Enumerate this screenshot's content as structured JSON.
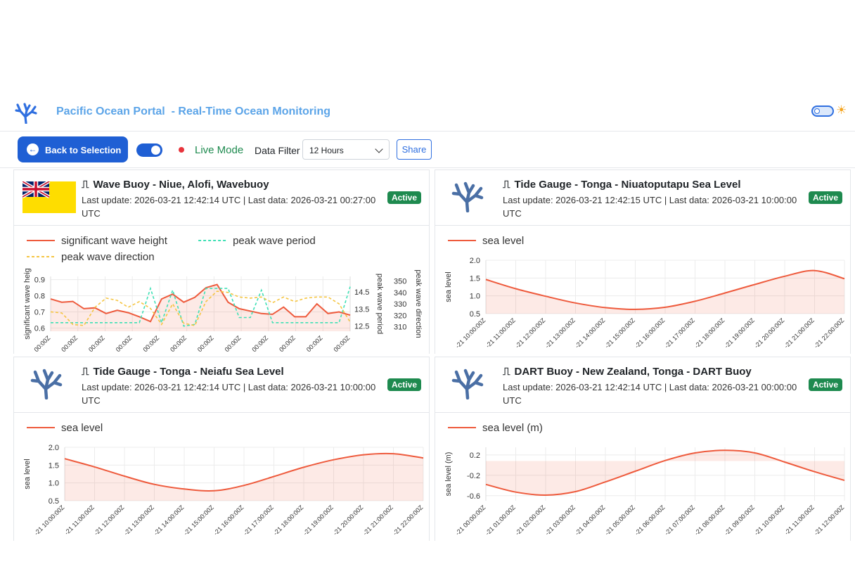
{
  "header": {
    "title": "Pacific Ocean Portal  - Real-Time Ocean Monitoring",
    "logo_icon": "coral-logo-icon",
    "theme_icon": "sun-icon",
    "brand_color": "#5ba4e8"
  },
  "toolbar": {
    "back_label": "Back to Selection",
    "back_icon": "arrow-left-circle-icon",
    "live_label": "Live Mode",
    "filter_label": "Data Filter",
    "filter_value": "12 Hours",
    "share_label": "Share"
  },
  "cards": [
    {
      "title": "Wave Buoy - Niue, Alofi, Wavebuoy",
      "subtitle": "Last update: 2026-03-21 12:42:14 UTC | Last data: 2026-03-21 00:27:00 UTC",
      "status": "Active",
      "icon": "niue-flag"
    },
    {
      "title": "Tide Gauge - Tonga - Niuatoputapu Sea Level",
      "subtitle": "Last update: 2026-03-21 12:42:15 UTC | Last data: 2026-03-21 10:00:00 UTC",
      "status": "Active",
      "icon": "coral-icon"
    },
    {
      "title": "Tide Gauge - Tonga - Neiafu Sea Level",
      "subtitle": "Last update: 2026-03-21 12:42:14 UTC | Last data: 2026-03-21 10:00:00 UTC",
      "status": "Active",
      "icon": "coral-icon"
    },
    {
      "title": "DART Buoy - New Zealand, Tonga - DART Buoy",
      "subtitle": "Last update: 2026-03-21 12:42:14 UTC | Last data: 2026-03-21 00:00:00 UTC",
      "status": "Active",
      "icon": "coral-icon"
    }
  ],
  "colors": {
    "primary": "#1f5fd4",
    "active": "#1e8a4f",
    "live_dot": "#e8343c",
    "series_red": "#ee5a3c",
    "series_teal": "#3fe0b5",
    "series_yellow": "#f5c542"
  },
  "chart_data": [
    {
      "type": "line",
      "legend": [
        "significant wave height",
        "peak wave period",
        "peak wave direction"
      ],
      "ylabel": "significant wave heig",
      "y2label": "peak wave period",
      "y3label": "peak wave direction",
      "yticks": [
        "0.9",
        "0.8",
        "0.7",
        "0.6"
      ],
      "y2ticks": [
        "14.5",
        "13.5",
        "12.5"
      ],
      "y3ticks": [
        "350",
        "340",
        "330",
        "320",
        "310"
      ],
      "ylim": [
        0.58,
        0.92
      ],
      "y2lim": [
        12.2,
        15.4
      ],
      "y3lim": [
        306,
        354
      ],
      "xticks": [
        "00:00Z",
        "00:00Z",
        "00:00Z",
        "00:00Z",
        "00:00Z",
        "00:00Z",
        "00:00Z",
        "00:00Z",
        "00:00Z",
        "00:00Z",
        "00:00Z",
        "00:00Z"
      ],
      "series": [
        {
          "name": "significant wave height",
          "style": "solid",
          "fill": true,
          "values": [
            0.78,
            0.76,
            0.765,
            0.72,
            0.725,
            0.69,
            0.71,
            0.695,
            0.67,
            0.64,
            0.78,
            0.81,
            0.76,
            0.79,
            0.85,
            0.87,
            0.76,
            0.72,
            0.705,
            0.69,
            0.685,
            0.73,
            0.67,
            0.67,
            0.75,
            0.69,
            0.7,
            0.68
          ]
        },
        {
          "name": "peak wave period",
          "style": "dashed",
          "values": [
            12.7,
            12.7,
            12.7,
            12.7,
            12.7,
            12.7,
            12.7,
            12.7,
            12.7,
            14.7,
            12.7,
            14.6,
            12.5,
            12.6,
            14.7,
            14.7,
            14.7,
            13.0,
            13.0,
            14.6,
            12.7,
            12.7,
            12.7,
            12.7,
            12.7,
            12.7,
            12.7,
            14.8
          ]
        },
        {
          "name": "peak wave direction",
          "style": "dashed",
          "values": [
            323,
            322,
            312,
            311,
            327,
            335,
            333,
            327,
            332,
            326,
            312,
            330,
            313,
            311,
            332,
            341,
            340,
            336,
            335,
            336,
            331,
            336,
            332,
            335,
            336,
            336,
            330,
            314
          ]
        }
      ]
    },
    {
      "type": "line",
      "legend": [
        "sea level"
      ],
      "ylabel": "sea level",
      "yticks": [
        "2.0",
        "1.5",
        "1.0",
        "0.5"
      ],
      "ylim": [
        0.5,
        2.0
      ],
      "xticks": [
        "-21 10:00:00Z",
        "-21 11:00:00Z",
        "-21 12:00:00Z",
        "-21 13:00:00Z",
        "-21 14:00:00Z",
        "-21 15:00:00Z",
        "-21 16:00:00Z",
        "-21 17:00:00Z",
        "-21 18:00:00Z",
        "-21 19:00:00Z",
        "-21 20:00:00Z",
        "-21 21:00:00Z",
        "-21 22:00:00Z"
      ],
      "series": [
        {
          "name": "sea level",
          "style": "solid",
          "fill": true,
          "values": [
            1.46,
            1.2,
            0.99,
            0.8,
            0.67,
            0.62,
            0.68,
            0.85,
            1.08,
            1.32,
            1.55,
            1.71,
            1.48
          ]
        }
      ]
    },
    {
      "type": "line",
      "legend": [
        "sea level"
      ],
      "ylabel": "sea level",
      "yticks": [
        "2.0",
        "1.5",
        "1.0",
        "0.5"
      ],
      "ylim": [
        0.5,
        2.0
      ],
      "xticks": [
        "-21 10:00:00Z",
        "-21 11:00:00Z",
        "-21 12:00:00Z",
        "-21 13:00:00Z",
        "-21 14:00:00Z",
        "-21 15:00:00Z",
        "-21 16:00:00Z",
        "-21 17:00:00Z",
        "-21 18:00:00Z",
        "-21 19:00:00Z",
        "-21 20:00:00Z",
        "-21 21:00:00Z",
        "-21 22:00:00Z"
      ],
      "series": [
        {
          "name": "sea level",
          "style": "solid",
          "fill": true,
          "values": [
            1.68,
            1.45,
            1.19,
            0.96,
            0.83,
            0.78,
            0.93,
            1.18,
            1.44,
            1.65,
            1.79,
            1.82,
            1.7
          ]
        }
      ]
    },
    {
      "type": "line",
      "legend": [
        "sea level (m)"
      ],
      "ylabel": "sea level (m)",
      "yticks": [
        "0.2",
        "-0.2",
        "-0.6"
      ],
      "ylim": [
        -0.7,
        0.35
      ],
      "fill_to": 0.08,
      "xticks": [
        "-21 00:00:00Z",
        "-21 01:00:00Z",
        "-21 02:00:00Z",
        "-21 03:00:00Z",
        "-21 04:00:00Z",
        "-21 05:00:00Z",
        "-21 06:00:00Z",
        "-21 07:00:00Z",
        "-21 08:00:00Z",
        "-21 09:00:00Z",
        "-21 10:00:00Z",
        "-21 11:00:00Z",
        "-21 12:00:00Z"
      ],
      "series": [
        {
          "name": "sea level (m)",
          "style": "solid",
          "fill": true,
          "values": [
            -0.38,
            -0.53,
            -0.59,
            -0.52,
            -0.33,
            -0.12,
            0.09,
            0.24,
            0.29,
            0.24,
            0.06,
            -0.13,
            -0.3
          ]
        }
      ]
    }
  ]
}
